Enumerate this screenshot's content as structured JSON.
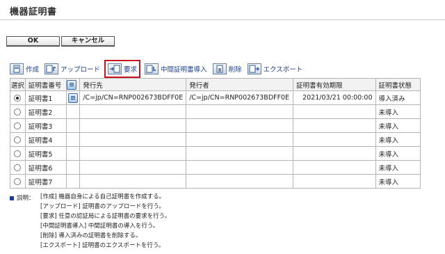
{
  "page": {
    "title": "機器証明書"
  },
  "actions": {
    "ok": "OK",
    "cancel": "キャンセル"
  },
  "toolbar": {
    "items": [
      {
        "label": "作成",
        "icon": "create-icon"
      },
      {
        "label": "アップロード",
        "icon": "upload-icon"
      },
      {
        "label": "要求",
        "icon": "request-icon",
        "selected": true
      },
      {
        "label": "中間証明書導入",
        "icon": "intermediate-import-icon"
      },
      {
        "label": "削除",
        "icon": "delete-icon"
      },
      {
        "label": "エクスポート",
        "icon": "export-icon"
      }
    ]
  },
  "table": {
    "headers": {
      "select": "選択",
      "number": "証明書番号",
      "to": "発行先",
      "from": "発行者",
      "expiry": "証明書有効期限",
      "status": "証明書状態"
    },
    "rows": [
      {
        "number": "証明書1",
        "selected": true,
        "has_detail": true,
        "to": "/C=jp/CN=RNP002673BDFF0E",
        "from": "/C=jp/CN=RNP002673BDFF0E",
        "expiry": "2021/03/21 00:00:00",
        "status": "導入済み"
      },
      {
        "number": "証明書2",
        "status": "未導入"
      },
      {
        "number": "証明書3",
        "status": "未導入"
      },
      {
        "number": "証明書4",
        "status": "未導入"
      },
      {
        "number": "証明書5",
        "status": "未導入"
      },
      {
        "number": "証明書6",
        "status": "未導入"
      },
      {
        "number": "証明書7",
        "status": "未導入"
      }
    ]
  },
  "description": {
    "heading": "説明：",
    "lines": [
      "[作成] 機器自身による自己証明書を作成する。",
      "[アップロード] 証明書のアップロードを行う。",
      "[要求] 任意の認証局による証明書の要求を行う。",
      "[中間証明書導入] 中間証明書の導入を行う。",
      "[削除] 導入済みの証明書を削除する。",
      "[エクスポート] 証明書のエクスポートを行う。"
    ]
  },
  "colors": {
    "link": "#1a3d8f",
    "highlight_border": "#c8141e"
  }
}
